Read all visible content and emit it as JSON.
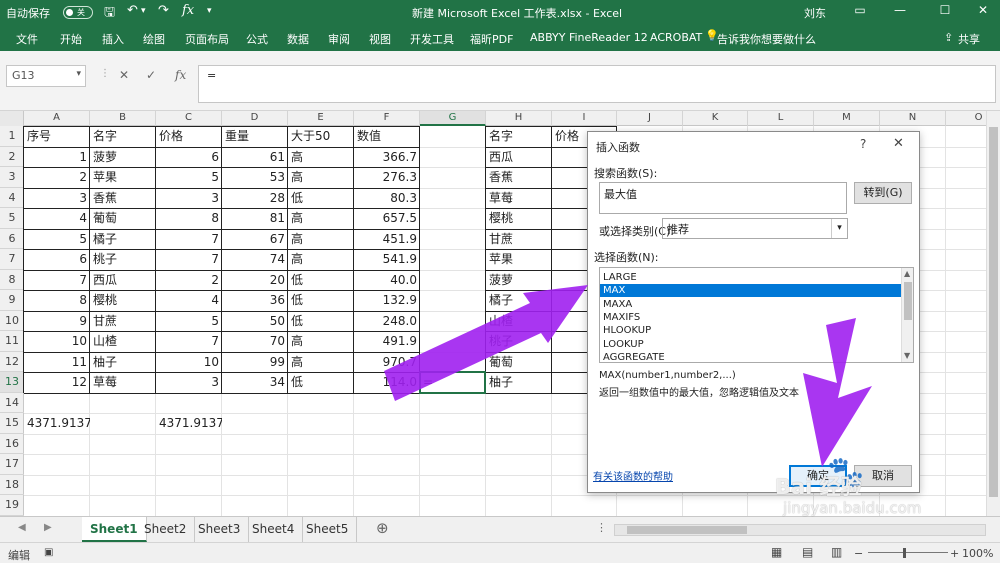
{
  "titlebar": {
    "autosave": "自动保存",
    "autosave_state": "关",
    "fx": "fx",
    "title": "新建 Microsoft Excel 工作表.xlsx  -  Excel",
    "user": "刘东"
  },
  "ribbon": {
    "tabs": [
      "文件",
      "开始",
      "插入",
      "绘图",
      "页面布局",
      "公式",
      "数据",
      "审阅",
      "视图",
      "开发工具",
      "福昕PDF",
      "ABBYY FineReader 12",
      "ACROBAT",
      "告诉我你想要做什么"
    ],
    "share": "共享"
  },
  "formula_bar": {
    "namebox": "G13",
    "fx": "fx",
    "content": "="
  },
  "columns": [
    "A",
    "B",
    "C",
    "D",
    "E",
    "F",
    "G",
    "H",
    "I",
    "J",
    "K",
    "L",
    "M",
    "N",
    "O"
  ],
  "rows": [
    "1",
    "2",
    "3",
    "4",
    "5",
    "6",
    "7",
    "8",
    "9",
    "10",
    "11",
    "12",
    "13",
    "14",
    "15",
    "16",
    "17",
    "18",
    "19"
  ],
  "table": {
    "headers": [
      "序号",
      "名字",
      "价格",
      "重量",
      "大于50",
      "数值"
    ],
    "rows": [
      [
        "1",
        "菠萝",
        "6",
        "61",
        "高",
        "366.7"
      ],
      [
        "2",
        "苹果",
        "5",
        "53",
        "高",
        "276.3"
      ],
      [
        "3",
        "香蕉",
        "3",
        "28",
        "低",
        "80.3"
      ],
      [
        "4",
        "葡萄",
        "8",
        "81",
        "高",
        "657.5"
      ],
      [
        "5",
        "橘子",
        "7",
        "67",
        "高",
        "451.9"
      ],
      [
        "6",
        "桃子",
        "7",
        "74",
        "高",
        "541.9"
      ],
      [
        "7",
        "西瓜",
        "2",
        "20",
        "低",
        "40.0"
      ],
      [
        "8",
        "樱桃",
        "4",
        "36",
        "低",
        "132.9"
      ],
      [
        "9",
        "甘蔗",
        "5",
        "50",
        "低",
        "248.0"
      ],
      [
        "10",
        "山楂",
        "7",
        "70",
        "高",
        "491.9"
      ],
      [
        "11",
        "柚子",
        "10",
        "99",
        "高",
        "970.7"
      ],
      [
        "12",
        "草莓",
        "3",
        "34",
        "低",
        "114.0"
      ]
    ],
    "g13": "=",
    "a15": "4371.9137",
    "c15": "4371.9137"
  },
  "second_table": {
    "headers": [
      "名字",
      "价格"
    ],
    "names": [
      "西瓜",
      "香蕉",
      "草莓",
      "樱桃",
      "甘蔗",
      "苹果",
      "菠萝",
      "橘子",
      "山楂",
      "桃子",
      "葡萄",
      "柚子"
    ]
  },
  "sheets": [
    "Sheet1",
    "Sheet2",
    "Sheet3",
    "Sheet4",
    "Sheet5"
  ],
  "status": {
    "mode": "编辑",
    "zoom": "100%"
  },
  "dialog": {
    "title": "插入函数",
    "help": "?",
    "close": "✕",
    "search_label": "搜索函数(S):",
    "search_value": "最大值",
    "go_button": "转到(G)",
    "category_label": "或选择类别(C):",
    "category_value": "推荐",
    "select_label": "选择函数(N):",
    "functions": [
      "LARGE",
      "MAX",
      "MAXA",
      "MAXIFS",
      "HLOOKUP",
      "LOOKUP",
      "AGGREGATE"
    ],
    "selected_index": 1,
    "syntax": "MAX(number1,number2,...)",
    "description": "返回一组数值中的最大值，忽略逻辑值及文本",
    "help_link": "有关该函数的帮助",
    "ok": "确定",
    "cancel": "取消"
  },
  "watermark": {
    "brand": "Bai 经验",
    "url": "jingyan.baidu.com"
  },
  "colors": {
    "excel_green": "#217346",
    "arrow_purple": "#a020f0",
    "selection_blue": "#0078d7"
  }
}
